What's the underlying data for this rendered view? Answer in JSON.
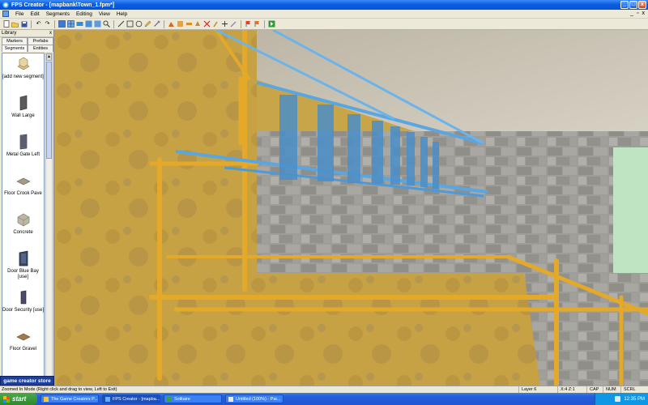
{
  "window": {
    "title": "FPS Creator - [mapbank\\Town_1.fpm*]",
    "minimize": "_",
    "maximize": "□",
    "close": "x"
  },
  "menubar": {
    "items": [
      "File",
      "Edit",
      "Segments",
      "Editing",
      "View",
      "Help"
    ],
    "mdi": [
      "_",
      "▫",
      "x"
    ]
  },
  "library": {
    "title": "Library",
    "close": "x",
    "tabs_row1": [
      "Markers",
      "Prefabs"
    ],
    "tabs_row2": [
      "Segments",
      "Entities"
    ],
    "items": [
      {
        "label": "[add new segment]",
        "icon": "add-segment-icon"
      },
      {
        "label": "Wall Large",
        "icon": "wall-icon"
      },
      {
        "label": "Metal Gate Left",
        "icon": "gate-icon"
      },
      {
        "label": "Floor Crook Pave",
        "icon": "floor-icon"
      },
      {
        "label": "Concrete",
        "icon": "concrete-icon"
      },
      {
        "label": "Door Blue Bay [use]",
        "icon": "door-icon"
      },
      {
        "label": "Door Security [use]",
        "icon": "door-security-icon"
      },
      {
        "label": "Floor Gravel",
        "icon": "floor-icon"
      }
    ],
    "store_label": "game creator store"
  },
  "statusbar": {
    "message": "Zoomed In Mode (Right click and drag to view, Left to Exit)",
    "layer": "Layer 6",
    "coords": "X:4 Z:1",
    "cap": "CAP",
    "num": "NUM",
    "scrl": "SCRL"
  },
  "taskbar": {
    "start_label": "start",
    "tasks": [
      {
        "label": "The Game Creators P...",
        "active": false
      },
      {
        "label": "FPS Creator - [mapba...",
        "active": true
      },
      {
        "label": "Solitaire",
        "active": false
      },
      {
        "label": "Untitled (100%) - Pai...",
        "active": false
      }
    ],
    "clock": "12:35 PM"
  },
  "colors": {
    "titlebar": "#0a5ee0",
    "chrome": "#ece9d8",
    "wall_yellow": "#c9a54a",
    "scaffold": "#e2a623",
    "ladder_blue": "#5aa6e0",
    "stone": "#9a9a96",
    "store_blue": "#1e3f9a"
  }
}
